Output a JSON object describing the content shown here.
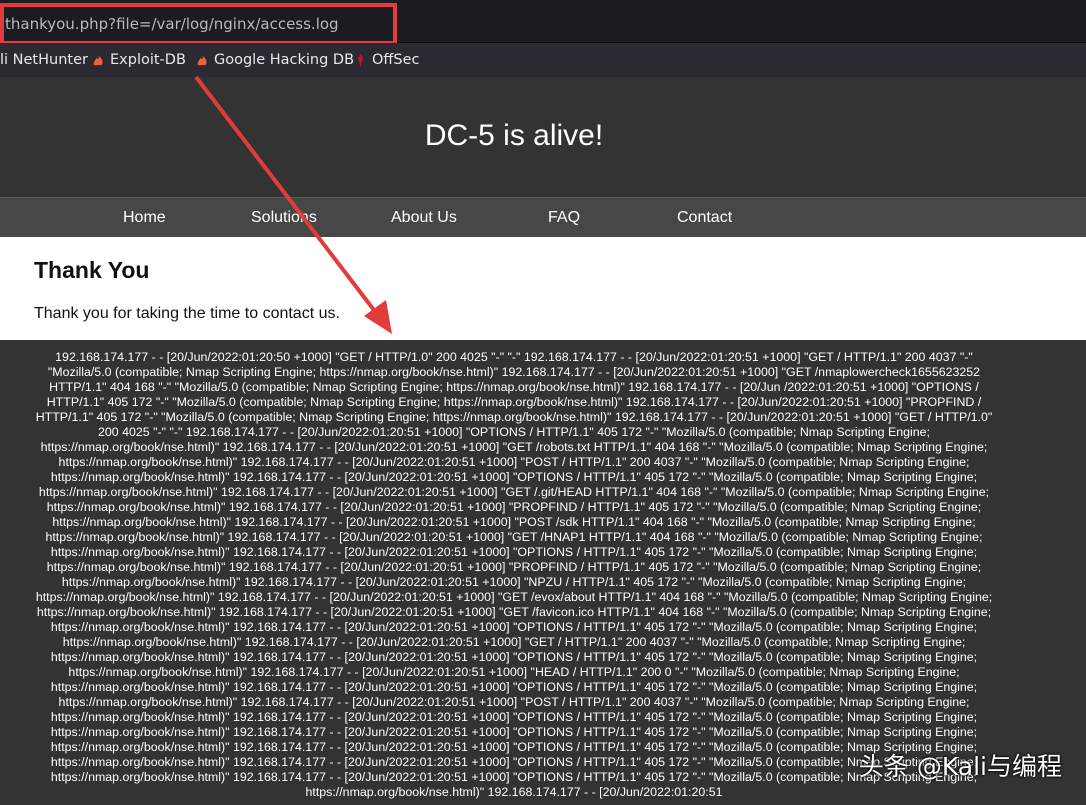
{
  "browser": {
    "url": "thankyou.php?file=/var/log/nginx/access.log",
    "bookmarks": [
      {
        "label": "li NetHunter",
        "icon": "none"
      },
      {
        "label": "Exploit-DB",
        "icon": "exploitdb-flame-icon"
      },
      {
        "label": "Google Hacking DB",
        "icon": "ghdb-flame-icon"
      },
      {
        "label": "OffSec",
        "icon": "offsec-icon"
      }
    ],
    "colors": {
      "toolbar": "#1c1b22",
      "bookmarks_bar": "#2b2a33",
      "highlight": "#e23b3b"
    }
  },
  "site": {
    "title": "DC-5 is alive!",
    "nav": [
      "Home",
      "Solutions",
      "About Us",
      "FAQ",
      "Contact"
    ],
    "heading": "Thank You",
    "message": "Thank you for taking the time to contact us.",
    "log_text": "192.168.174.177 - - [20/Jun/2022:01:20:50 +1000] \"GET / HTTP/1.0\" 200 4025 \"-\" \"-\" 192.168.174.177 - - [20/Jun/2022:01:20:51 +1000] \"GET / HTTP/1.1\" 200 4037 \"-\" \"Mozilla/5.0 (compatible; Nmap Scripting Engine; https://nmap.org/book/nse.html)\" 192.168.174.177 - - [20/Jun/2022:01:20:51 +1000] \"GET /nmaplowercheck1655623252 HTTP/1.1\" 404 168 \"-\" \"Mozilla/5.0 (compatible; Nmap Scripting Engine; https://nmap.org/book/nse.html)\" 192.168.174.177 - - [20/Jun /2022:01:20:51 +1000] \"OPTIONS / HTTP/1.1\" 405 172 \"-\" \"Mozilla/5.0 (compatible; Nmap Scripting Engine; https://nmap.org/book/nse.html)\" 192.168.174.177 - - [20/Jun/2022:01:20:51 +1000] \"PROPFIND / HTTP/1.1\" 405 172 \"-\" \"Mozilla/5.0 (compatible; Nmap Scripting Engine; https://nmap.org/book/nse.html)\" 192.168.174.177 - - [20/Jun/2022:01:20:51 +1000] \"GET / HTTP/1.0\" 200 4025 \"-\" \"-\" 192.168.174.177 - - [20/Jun/2022:01:20:51 +1000] \"OPTIONS / HTTP/1.1\" 405 172 \"-\" \"Mozilla/5.0 (compatible; Nmap Scripting Engine; https://nmap.org/book/nse.html)\" 192.168.174.177 - - [20/Jun/2022:01:20:51 +1000] \"GET /robots.txt HTTP/1.1\" 404 168 \"-\" \"Mozilla/5.0 (compatible; Nmap Scripting Engine; https://nmap.org/book/nse.html)\" 192.168.174.177 - - [20/Jun/2022:01:20:51 +1000] \"POST / HTTP/1.1\" 200 4037 \"-\" \"Mozilla/5.0 (compatible; Nmap Scripting Engine; https://nmap.org/book/nse.html)\" 192.168.174.177 - - [20/Jun/2022:01:20:51 +1000] \"OPTIONS / HTTP/1.1\" 405 172 \"-\" \"Mozilla/5.0 (compatible; Nmap Scripting Engine; https://nmap.org/book/nse.html)\" 192.168.174.177 - - [20/Jun/2022:01:20:51 +1000] \"GET /.git/HEAD HTTP/1.1\" 404 168 \"-\" \"Mozilla/5.0 (compatible; Nmap Scripting Engine; https://nmap.org/book/nse.html)\" 192.168.174.177 - - [20/Jun/2022:01:20:51 +1000] \"PROPFIND / HTTP/1.1\" 405 172 \"-\" \"Mozilla/5.0 (compatible; Nmap Scripting Engine; https://nmap.org/book/nse.html)\" 192.168.174.177 - - [20/Jun/2022:01:20:51 +1000] \"POST /sdk HTTP/1.1\" 404 168 \"-\" \"Mozilla/5.0 (compatible; Nmap Scripting Engine; https://nmap.org/book/nse.html)\" 192.168.174.177 - - [20/Jun/2022:01:20:51 +1000] \"GET /HNAP1 HTTP/1.1\" 404 168 \"-\" \"Mozilla/5.0 (compatible; Nmap Scripting Engine; https://nmap.org/book/nse.html)\" 192.168.174.177 - - [20/Jun/2022:01:20:51 +1000] \"OPTIONS / HTTP/1.1\" 405 172 \"-\" \"Mozilla/5.0 (compatible; Nmap Scripting Engine; https://nmap.org/book/nse.html)\" 192.168.174.177 - - [20/Jun/2022:01:20:51 +1000] \"PROPFIND / HTTP/1.1\" 405 172 \"-\" \"Mozilla/5.0 (compatible; Nmap Scripting Engine; https://nmap.org/book/nse.html)\" 192.168.174.177 - - [20/Jun/2022:01:20:51 +1000] \"NPZU / HTTP/1.1\" 405 172 \"-\" \"Mozilla/5.0 (compatible; Nmap Scripting Engine; https://nmap.org/book/nse.html)\" 192.168.174.177 - - [20/Jun/2022:01:20:51 +1000] \"GET /evox/about HTTP/1.1\" 404 168 \"-\" \"Mozilla/5.0 (compatible; Nmap Scripting Engine; https://nmap.org/book/nse.html)\" 192.168.174.177 - - [20/Jun/2022:01:20:51 +1000] \"GET /favicon.ico HTTP/1.1\" 404 168 \"-\" \"Mozilla/5.0 (compatible; Nmap Scripting Engine; https://nmap.org/book/nse.html)\" 192.168.174.177 - - [20/Jun/2022:01:20:51 +1000] \"OPTIONS / HTTP/1.1\" 405 172 \"-\" \"Mozilla/5.0 (compatible; Nmap Scripting Engine; https://nmap.org/book/nse.html)\" 192.168.174.177 - - [20/Jun/2022:01:20:51 +1000] \"GET / HTTP/1.1\" 200 4037 \"-\" \"Mozilla/5.0 (compatible; Nmap Scripting Engine; https://nmap.org/book/nse.html)\" 192.168.174.177 - - [20/Jun/2022:01:20:51 +1000] \"OPTIONS / HTTP/1.1\" 405 172 \"-\" \"Mozilla/5.0 (compatible; Nmap Scripting Engine; https://nmap.org/book/nse.html)\" 192.168.174.177 - - [20/Jun/2022:01:20:51 +1000] \"HEAD / HTTP/1.1\" 200 0 \"-\" \"Mozilla/5.0 (compatible; Nmap Scripting Engine; https://nmap.org/book/nse.html)\" 192.168.174.177 - - [20/Jun/2022:01:20:51 +1000] \"OPTIONS / HTTP/1.1\" 405 172 \"-\" \"Mozilla/5.0 (compatible; Nmap Scripting Engine; https://nmap.org/book/nse.html)\" 192.168.174.177 - - [20/Jun/2022:01:20:51 +1000] \"POST / HTTP/1.1\" 200 4037 \"-\" \"Mozilla/5.0 (compatible; Nmap Scripting Engine; https://nmap.org/book/nse.html)\" 192.168.174.177 - - [20/Jun/2022:01:20:51 +1000] \"OPTIONS / HTTP/1.1\" 405 172 \"-\" \"Mozilla/5.0 (compatible; Nmap Scripting Engine; https://nmap.org/book/nse.html)\" 192.168.174.177 - - [20/Jun/2022:01:20:51 +1000] \"OPTIONS / HTTP/1.1\" 405 172 \"-\" \"Mozilla/5.0 (compatible; Nmap Scripting Engine; https://nmap.org/book/nse.html)\" 192.168.174.177 - - [20/Jun/2022:01:20:51 +1000] \"OPTIONS / HTTP/1.1\" 405 172 \"-\" \"Mozilla/5.0 (compatible; Nmap Scripting Engine; https://nmap.org/book/nse.html)\" 192.168.174.177 - - [20/Jun/2022:01:20:51 +1000] \"OPTIONS / HTTP/1.1\" 405 172 \"-\" \"Mozilla/5.0 (compatible; Nmap Scripting Engine; https://nmap.org/book/nse.html)\" 192.168.174.177 - - [20/Jun/2022:01:20:51 +1000] \"OPTIONS / HTTP/1.1\" 405 172 \"-\" \"Mozilla/5.0 (compatible; Nmap Scripting Engine; https://nmap.org/book/nse.html)\" 192.168.174.177 - - [20/Jun/2022:01:20:51"
  },
  "annotation": {
    "arrow_color": "#e23b3b"
  },
  "watermark": "头条 @Kali与编程"
}
